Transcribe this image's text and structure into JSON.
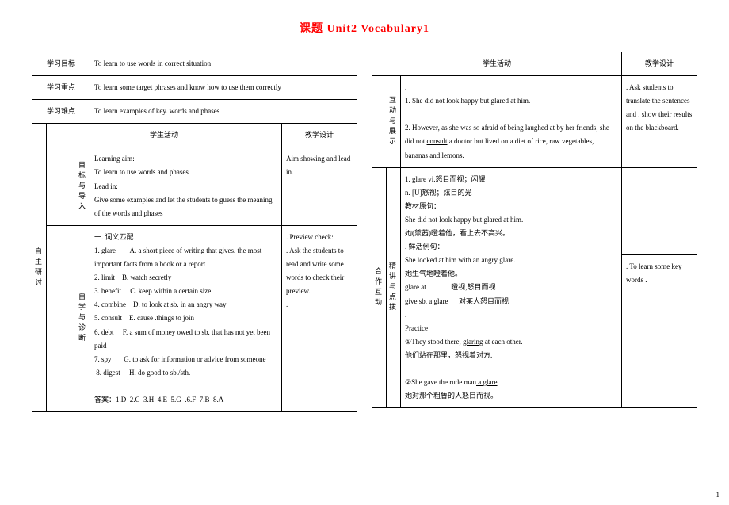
{
  "title": "课题 Unit2  Vocabulary1",
  "left": {
    "row1_label": "学习目标",
    "row1_text": "To learn to use words in correct situation",
    "row2_label": "学习重点",
    "row2_text": "To learn some target phrases and know how to use them correctly",
    "row3_label": "学习难点",
    "row3_text": "To learn examples of key. words and phases",
    "side": "自主研讨",
    "h_activity": "学生活动",
    "h_design": "教学设计",
    "sec1_label": "目标与导入",
    "sec1_activity": "Learning aim:\nTo learn to use words and phases\nLead in:\nGive some examples and let the students to guess the meaning of the words and phases",
    "sec1_design": "Aim showing and lead in.",
    "sec2_label": "自学与诊断",
    "sec2_activity": "一. 词义匹配\n1. glare        A. a short piece of writing that gives. the most important facts from a book or a report\n2. limit    B. watch secretly\n3. benefit     C. keep within a certain size\n4. combine    D. to look at sb. in an angry way\n5. consult    E. cause .things to join\n6. debt     F. a sum of money owed to sb. that has not yet been paid\n7. spy       G. to ask for information or advice from someone\n 8. digest     H. do good to sb./sth.\n\n答案：1.D  2.C  3.H  4.E  5.G  .6.F  7.B  8.A",
    "sec2_design": ". Preview check:\n. Ask the students to read and write some words to check their preview.\n."
  },
  "right": {
    "h_activity": "学生活动",
    "h_design": "教学设计",
    "side1": "互动与展示",
    "sec1_activity_pre": ".\n1. She did not look happy but glared at him.\n\n2. However, as she was so afraid of being laughed at by her friends, she did not ",
    "sec1_activity_u": "consult",
    "sec1_activity_post": " a doctor but lived on a diet of rice, raw vegetables, bananas and lemons.",
    "sec1_design": ". Ask students to translate the sentences and . show their results on the blackboard.",
    "side2a": "合作互动",
    "side2b": "精讲与点拨",
    "sec2_activity_block1": "1. glare vi.怒目而视；闪耀\nn. [U]怒视；炫目的光\n教材原句：\nShe did not look happy but glared at him.\n她(黛茜)瞪着他，看上去不高兴。\n. 鲜活例句：\nShe looked at him with an angry glare.\n她生气地瞪着他。\nglare at              瞪视,怒目而视\ngive sb. a glare      对某人怒目而视\n.\nPractice",
    "sec2_activity_p1_pre": "①They stood there, ",
    "sec2_activity_p1_u": "glaring",
    "sec2_activity_p1_post": " at each other.",
    "sec2_activity_line2": "他们站在那里，怒视着对方.",
    "sec2_activity_p2_pre": "②She gave the rude man",
    "sec2_activity_p2_u": " a glare",
    "sec2_activity_p2_post": ".",
    "sec2_activity_line4": "她对那个粗鲁的人怒目而视。",
    "sec2_design": ". To learn some key words ."
  },
  "page_num": "1"
}
